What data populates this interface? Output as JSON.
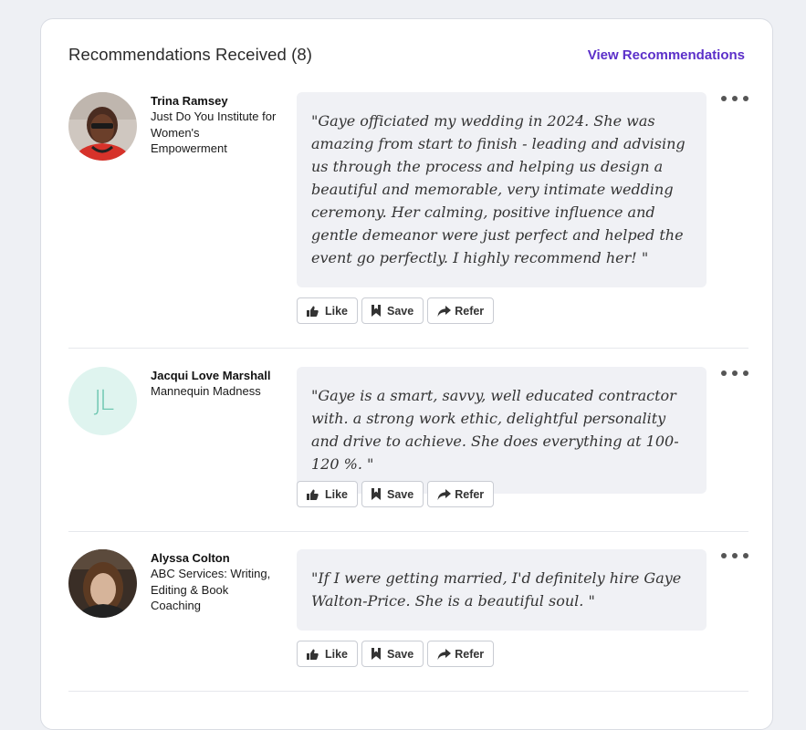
{
  "header": {
    "title": "Recommendations Received (8)",
    "view_link": "View Recommendations"
  },
  "colors": {
    "accent": "#5b2fc9",
    "quote_bg": "#f0f1f5",
    "initials_bg": "#dff4ef",
    "initials_fg": "#6fc7b1"
  },
  "actions": {
    "like": "Like",
    "save": "Save",
    "refer": "Refer"
  },
  "recommendations": [
    {
      "name": "Trina Ramsey",
      "org": "Just Do You Institute for Women's Empowerment",
      "avatar": "photo",
      "quote": "\"Gaye officiated my wedding in 2024. She was amazing from start to finish - leading and advising us through the process and helping us design a beautiful and memorable, very intimate wedding ceremony. Her calming, positive influence and gentle demeanor were just perfect and helped the event go perfectly. I highly recommend her! \""
    },
    {
      "name": "Jacqui Love Marshall",
      "org": "Mannequin Madness",
      "avatar": "initials",
      "initials": "JL",
      "quote": "\"Gaye is a smart, savvy, well educated contractor with. a strong work ethic, delightful personality and drive to achieve. She does everything at 100-120 %. \""
    },
    {
      "name": "Alyssa Colton",
      "org": "ABC Services: Writing, Editing & Book Coaching",
      "avatar": "photo",
      "quote": "\"If I were getting married, I'd definitely hire Gaye Walton-Price. She is a beautiful soul. \""
    }
  ]
}
